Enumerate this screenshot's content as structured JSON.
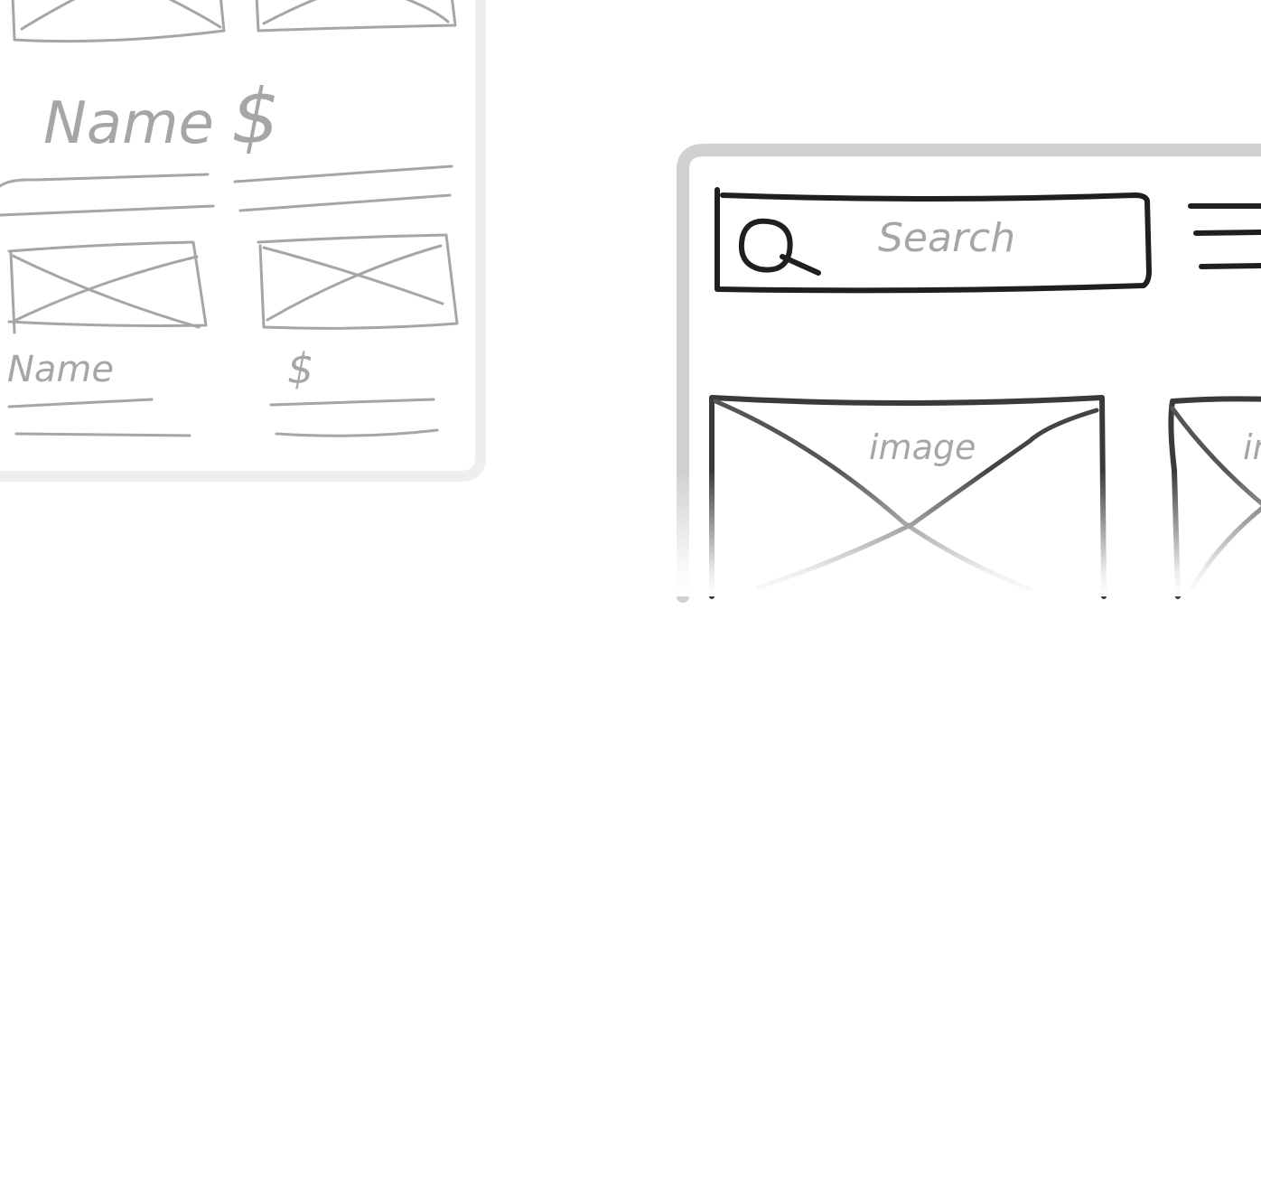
{
  "back_screen": {
    "product_name_large": "Name",
    "product_price_large": "$",
    "product_name_small": "Name",
    "product_price_small": "$"
  },
  "front_screen": {
    "search": {
      "placeholder": "Search"
    },
    "cards": [
      {
        "image_label": "image"
      },
      {
        "image_label": "image"
      }
    ]
  },
  "colors": {
    "back_stroke": "#a6a6a6",
    "front_stroke": "#1f1f1f",
    "frame": "#d0d0d0",
    "back_frame": "#eeeeee"
  }
}
